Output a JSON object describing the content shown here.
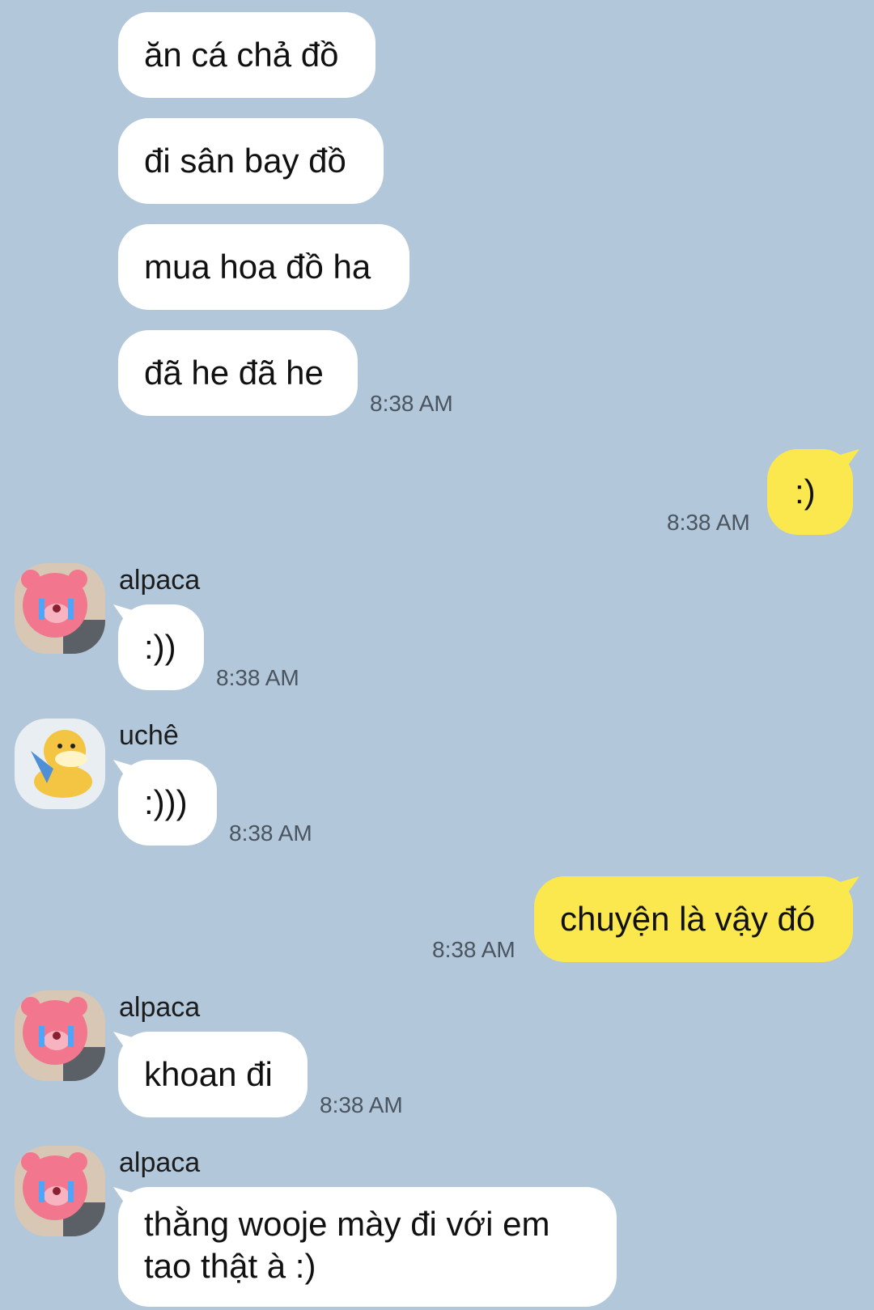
{
  "messages": [
    {
      "text": "ăn cá chả đồ"
    },
    {
      "text": "đi sân bay đồ"
    },
    {
      "text": "mua hoa đồ ha"
    },
    {
      "text": "đã he đã he",
      "time": "8:38 AM"
    },
    {
      "text": ":)",
      "time": "8:38 AM"
    },
    {
      "sender": "alpaca",
      "text": ":))",
      "time": "8:38 AM"
    },
    {
      "sender": "uchê",
      "text": ":)))",
      "time": "8:38 AM"
    },
    {
      "text": "chuyện là vậy đó",
      "time": "8:38 AM"
    },
    {
      "sender": "alpaca",
      "text": "khoan đi",
      "time": "8:38 AM"
    },
    {
      "sender": "alpaca",
      "text": "thằng wooje mày đi với em tao thật à :)"
    }
  ],
  "colors": {
    "background": "#b2c7da",
    "incoming_bubble": "#ffffff",
    "outgoing_bubble": "#fbe84f"
  },
  "avatars": {
    "alpaca": "pink-bear-crying-avatar",
    "uche": "yellow-duck-avatar"
  }
}
